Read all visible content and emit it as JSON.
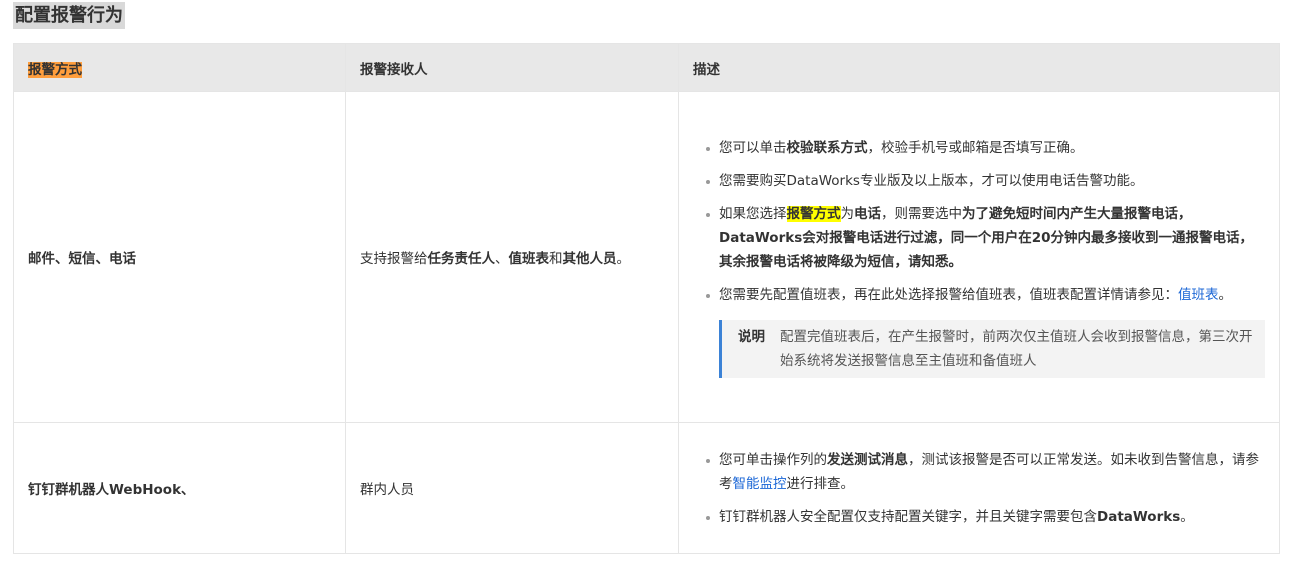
{
  "page_title": "配置报警行为",
  "headers": [
    "报警方式",
    "报警接收人",
    "描述"
  ],
  "row1": {
    "method": "邮件、短信、电话",
    "receiver": {
      "p1": "支持报警给",
      "b1": "任务责任人",
      "p2": "、",
      "b2": "值班表",
      "p3": "和",
      "b3": "其他人员",
      "p4": "。"
    },
    "b1": {
      "p1": "您可以单击",
      "b1": "校验联系方式",
      "p2": "，校验手机号或邮箱是否填写正确。"
    },
    "b2": "您需要购买DataWorks专业版及以上版本，才可以使用电话告警功能。",
    "b3": {
      "p1": "如果您选择",
      "h1": "报警方式",
      "p2": "为",
      "b1": "电话",
      "p3": "，则需要选中",
      "b2": "为了避免短时间内产生大量报警电话，DataWorks会对报警电话进行过滤，同一个用户在20分钟内最多接收到一通报警电话，其余报警电话将被降级为短信，请知悉。"
    },
    "b4": {
      "p1": "您需要先配置值班表，再在此处选择报警给值班表，值班表配置详情请参见：",
      "link": "值班表",
      "p2": "。"
    },
    "note": {
      "title": "说明",
      "text": "配置完值班表后，在产生报警时，前两次仅主值班人会收到报警信息，第三次开始系统将发送报警信息至主值班和备值班人"
    }
  },
  "row2": {
    "method": "钉钉群机器人WebHook、",
    "receiver": "群内人员",
    "b1": {
      "p1": "您可单击操作列的",
      "b1": "发送测试消息",
      "p2": "，测试该报警是否可以正常发送。如未收到告警信息，请参考",
      "link": "智能监控",
      "p3": "进行排查。"
    },
    "b2": {
      "p1": "钉钉群机器人安全配置仅支持配置关键字，并且关键字需要包含",
      "b1": "DataWorks",
      "p2": "。"
    }
  },
  "colors": {
    "header_bg": "#e8e8e8",
    "highlight_orange": "#ff9e3d",
    "highlight_yellow": "#ffff00",
    "link": "#1a66d6",
    "note_border": "#3b82d6"
  }
}
